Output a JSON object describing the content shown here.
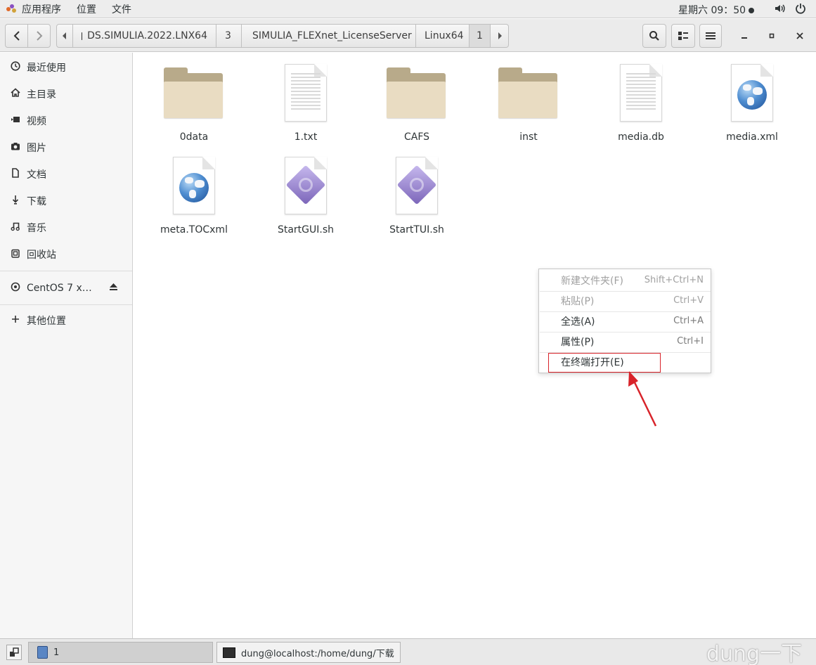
{
  "top_panel": {
    "menu": [
      "应用程序",
      "位置",
      "文件"
    ],
    "clock": "星期六 09：50"
  },
  "toolbar": {
    "breadcrumbs": [
      "DS.SIMULIA.2022.LNX64",
      "3",
      "SIMULIA_FLEXnet_LicenseServer",
      "Linux64",
      "1"
    ]
  },
  "sidebar": {
    "items": [
      {
        "label": "最近使用",
        "icon": "clock-icon"
      },
      {
        "label": "主目录",
        "icon": "home-icon"
      },
      {
        "label": "视频",
        "icon": "video-icon"
      },
      {
        "label": "图片",
        "icon": "camera-icon"
      },
      {
        "label": "文档",
        "icon": "document-icon"
      },
      {
        "label": "下载",
        "icon": "download-icon"
      },
      {
        "label": "音乐",
        "icon": "music-icon"
      },
      {
        "label": "回收站",
        "icon": "trash-icon"
      }
    ],
    "device": "CentOS 7 x…",
    "other_locations": "其他位置"
  },
  "files": [
    {
      "name": "0data",
      "type": "folder"
    },
    {
      "name": "1.txt",
      "type": "text"
    },
    {
      "name": "CAFS",
      "type": "folder"
    },
    {
      "name": "inst",
      "type": "folder"
    },
    {
      "name": "media.db",
      "type": "text"
    },
    {
      "name": "media.xml",
      "type": "xml"
    },
    {
      "name": "meta.TOCxml",
      "type": "xml"
    },
    {
      "name": "StartGUI.sh",
      "type": "script"
    },
    {
      "name": "StartTUI.sh",
      "type": "script"
    }
  ],
  "context_menu": {
    "items": [
      {
        "label": "新建文件夹(F)",
        "shortcut": "Shift+Ctrl+N",
        "enabled": false
      },
      {
        "label": "粘贴(P)",
        "shortcut": "Ctrl+V",
        "enabled": false
      },
      {
        "label": "全选(A)",
        "shortcut": "Ctrl+A",
        "enabled": true
      },
      {
        "label": "属性(P)",
        "shortcut": "Ctrl+I",
        "enabled": true
      },
      {
        "label": "在终端打开(E)",
        "shortcut": "",
        "enabled": true
      }
    ],
    "highlight_color": "#d8232a"
  },
  "taskbar": {
    "items": [
      {
        "label": "1"
      },
      {
        "label": "dung@localhost:/home/dung/下载"
      }
    ]
  },
  "watermark": "dung一下"
}
